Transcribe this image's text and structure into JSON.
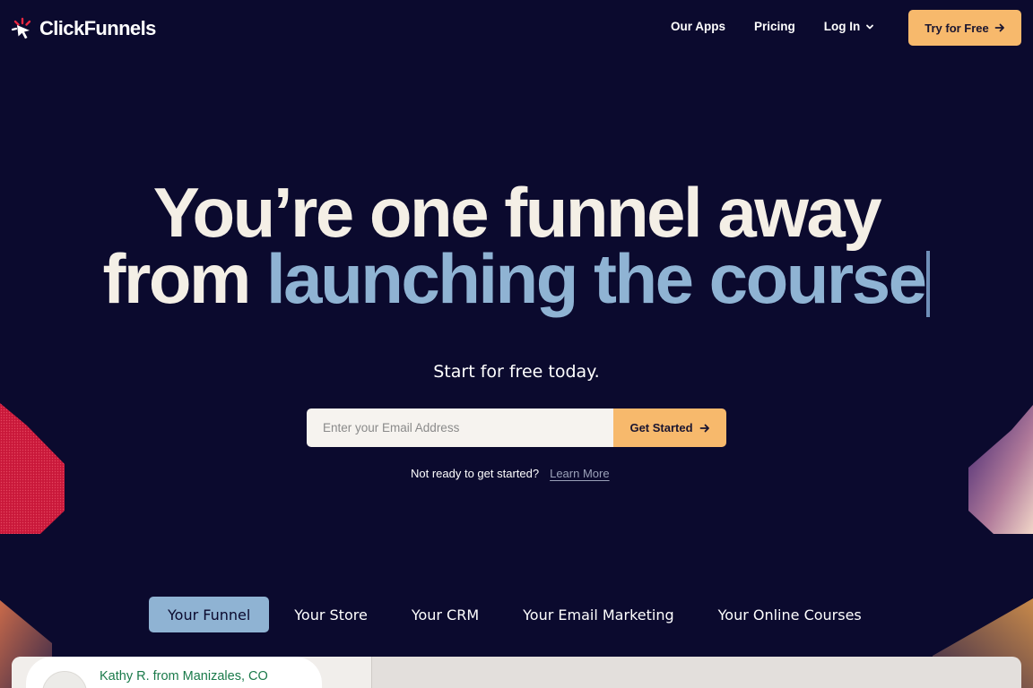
{
  "brand": {
    "name": "ClickFunnels",
    "logo_icon": "cursor-burst-icon"
  },
  "nav": {
    "items": [
      {
        "label": "Our Apps"
      },
      {
        "label": "Pricing"
      },
      {
        "label": "Log In",
        "icon": "chevron-down-icon"
      }
    ],
    "cta_label": "Try for Free"
  },
  "hero": {
    "line1": "You’re one funnel away",
    "line2_prefix": "from",
    "line2_accent": "launching the course",
    "subtitle": "Start for free today."
  },
  "form": {
    "email_placeholder": "Enter your Email Address",
    "email_value": "",
    "submit_label": "Get Started",
    "not_ready_text": "Not ready to get started?",
    "learn_more_label": "Learn More"
  },
  "tabs": [
    {
      "label": "Your Funnel",
      "active": true
    },
    {
      "label": "Your Store",
      "active": false
    },
    {
      "label": "Your CRM",
      "active": false
    },
    {
      "label": "Your Email Marketing",
      "active": false
    },
    {
      "label": "Your Online Courses",
      "active": false
    }
  ],
  "review": {
    "name": "Kathy R. from Manizales, CO"
  },
  "colors": {
    "background": "#0b0a2e",
    "accent_orange": "#f7b96c",
    "accent_blue": "#8fb3d3",
    "review_green": "#1a7a4a",
    "deco_red": "#d11f3e"
  }
}
